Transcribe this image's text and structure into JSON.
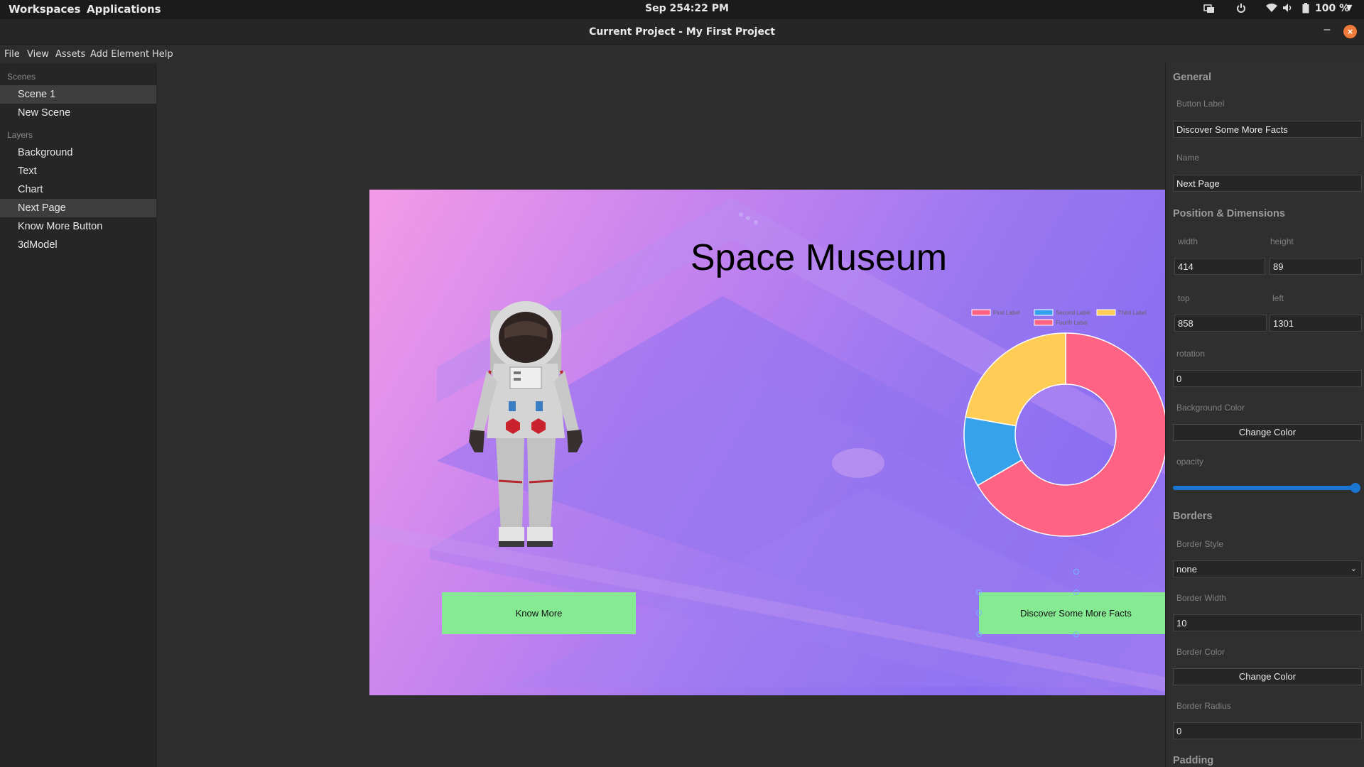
{
  "topbar": {
    "workspaces": "Workspaces",
    "applications": "Applications",
    "date": "Sep 25",
    "time": "4:22 PM",
    "battery": "100 %"
  },
  "window": {
    "title": "Current Project - My First Project",
    "close_glyph": "×",
    "minimize_glyph": "–"
  },
  "menu": [
    "File",
    "View",
    "Assets",
    "Add Element",
    "Help"
  ],
  "sidebar": {
    "scenes_header": "Scenes",
    "scenes": [
      {
        "label": "Scene 1",
        "active": true
      },
      {
        "label": "New Scene",
        "active": false
      }
    ],
    "layers_header": "Layers",
    "layers": [
      {
        "label": "Background",
        "active": false
      },
      {
        "label": "Text",
        "active": false
      },
      {
        "label": "Chart",
        "active": false
      },
      {
        "label": "Next Page",
        "active": true
      },
      {
        "label": "Know More Button",
        "active": false
      },
      {
        "label": "3dModel",
        "active": false
      }
    ]
  },
  "stage": {
    "title": "Space Museum",
    "know_more_label": "Know More",
    "discover_label": "Discover Some More Facts",
    "chart_data": {
      "type": "pie",
      "variant": "doughnut",
      "categories": [
        "First Label",
        "Second Label",
        "Third Label",
        "Fourth Label"
      ],
      "values": [
        300,
        50,
        100,
        0
      ],
      "colors": [
        "#ff6384",
        "#36a2eb",
        "#ffcd56",
        "#ff6384"
      ],
      "legend": "top"
    }
  },
  "props": {
    "general": "General",
    "button_label_lbl": "Button Label",
    "button_label_val": "Discover Some More Facts",
    "name_lbl": "Name",
    "name_val": "Next Page",
    "pos_dim": "Position & Dimensions",
    "width_lbl": "width",
    "width_val": "414",
    "height_lbl": "height",
    "height_val": "89",
    "top_lbl": "top",
    "top_val": "858",
    "left_lbl": "left",
    "left_val": "1301",
    "rotation_lbl": "rotation",
    "rotation_val": "0",
    "bg_color_lbl": "Background Color",
    "change_color": "Change Color",
    "opacity_lbl": "opacity",
    "opacity_value": 1.0,
    "borders": "Borders",
    "border_style_lbl": "Border Style",
    "border_style_val": "none",
    "border_width_lbl": "Border Width",
    "border_width_val": "10",
    "border_color_lbl": "Border Color",
    "border_radius_lbl": "Border Radius",
    "border_radius_val": "0",
    "padding": "Padding"
  }
}
